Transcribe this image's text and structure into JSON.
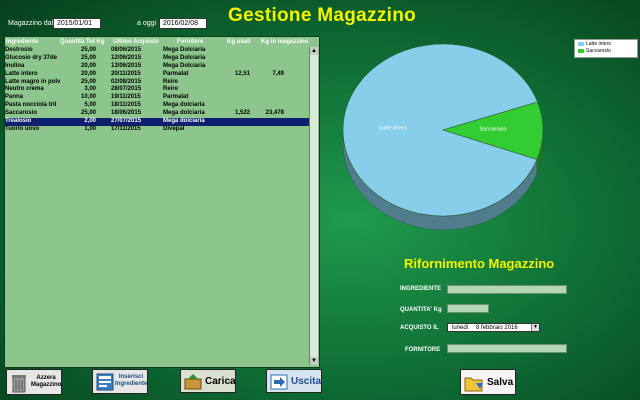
{
  "header": {
    "title": "Gestione Magazzino",
    "date_from_label": "Magazzino dal",
    "date_from_value": "2015/01/01",
    "date_to_label": "a oggi",
    "date_to_value": "2016/02/08"
  },
  "table": {
    "columns": [
      "Ingrediente",
      "Quantità Tot Kg",
      "Ultimo Acquisto",
      "Fornitore",
      "Kg usati",
      "Kg in magazzino"
    ],
    "rows": [
      [
        "Destrosio",
        "25,00",
        "08/06/2015",
        "Mega Dolciaria",
        "",
        ""
      ],
      [
        "Glucosio dry 37de",
        "25,00",
        "12/06/2015",
        "Mega Dolciaria",
        "",
        ""
      ],
      [
        "Inulina",
        "20,00",
        "13/06/2015",
        "Mega Dolciaria",
        "",
        ""
      ],
      [
        "Latte intero",
        "20,00",
        "20/11/2015",
        "Parmalat",
        "12,51",
        "7,49"
      ],
      [
        "Latte magro in polv",
        "25,00",
        "02/08/2015",
        "Reire",
        "",
        ""
      ],
      [
        "Neutro crema",
        "3,00",
        "28/07/2015",
        "Reire",
        "",
        ""
      ],
      [
        "Panna",
        "10,00",
        "19/11/2015",
        "Parmalat",
        "",
        ""
      ],
      [
        "Pasta nocciola tril",
        "5,00",
        "18/11/2015",
        "Mega dolciaria",
        "",
        ""
      ],
      [
        "Saccarosio",
        "25,00",
        "18/06/2015",
        "Mega dolciaria",
        "1,522",
        "23,478"
      ],
      [
        "Trealosio",
        "2,00",
        "27/07/2015",
        "Mega dolciaria",
        "",
        ""
      ],
      [
        "Tuorlo uovo",
        "1,00",
        "17/11/2015",
        "Divepal",
        "",
        ""
      ]
    ],
    "selected_index": 9
  },
  "chart_data": {
    "type": "pie",
    "labels": [
      "Latte intero",
      "Saccarosio"
    ],
    "values": [
      12.51,
      1.522
    ],
    "colors": [
      "#87ceeb",
      "#33cc33"
    ],
    "legend_position": "top-right"
  },
  "form": {
    "title": "Rifornimento Magazzino",
    "ingredient_label": "INGREDIENTE",
    "quantity_label": "QUANTITA' Kg",
    "purchase_label": "ACQUISTO IL",
    "date_weekday": "lunedì",
    "date_value": "8  febbraio  2016",
    "supplier_label": "FORNITORE"
  },
  "buttons": {
    "reset_label": "Azzera Magazzino",
    "insert_label": "Inserisci Ingrediente",
    "load_label": "Carica",
    "exit_label": "Uscita",
    "save_label": "Salva"
  },
  "colors": {
    "title": "#f4f400",
    "selection": "#0e1f6e",
    "list_bg": "#8cc68c"
  }
}
